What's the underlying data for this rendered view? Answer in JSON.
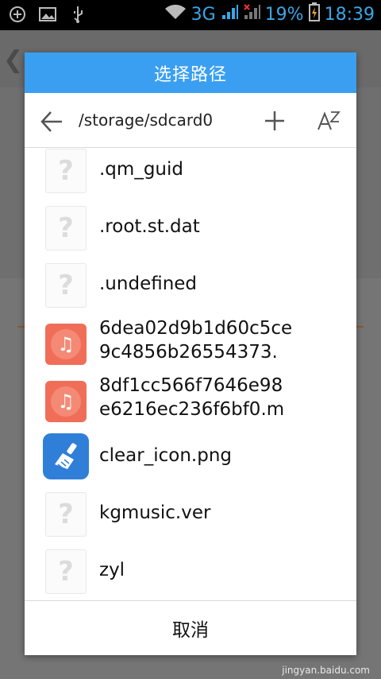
{
  "status_bar": {
    "network": "3G",
    "battery": "19%",
    "time": "18:39"
  },
  "dialog": {
    "title": "选择路径",
    "path": "/storage/sdcard0",
    "sort_label": "AZ",
    "cancel_label": "取消",
    "files": [
      {
        "name": ".qm_guid",
        "icon": "unknown-file-icon"
      },
      {
        "name": ".root.st.dat",
        "icon": "unknown-file-icon"
      },
      {
        "name": ".undefined",
        "icon": "unknown-file-icon"
      },
      {
        "name": "6dea02d9b1d60c5ce\n9c4856b26554373.",
        "icon": "music-file-icon"
      },
      {
        "name": "8df1cc566f7646e98\ne6216ec236f6bf0.m",
        "icon": "music-file-icon"
      },
      {
        "name": "clear_icon.png",
        "icon": "broom-app-icon"
      },
      {
        "name": "kgmusic.ver",
        "icon": "unknown-file-icon"
      },
      {
        "name": "zyl",
        "icon": "unknown-file-icon"
      }
    ]
  },
  "watermark": "jingyan.baidu.com",
  "colors": {
    "title_bar": "#3a9ff0",
    "status_text": "#3aa6e8",
    "music_icon": "#f06e58",
    "clear_icon": "#2f7fd9"
  }
}
